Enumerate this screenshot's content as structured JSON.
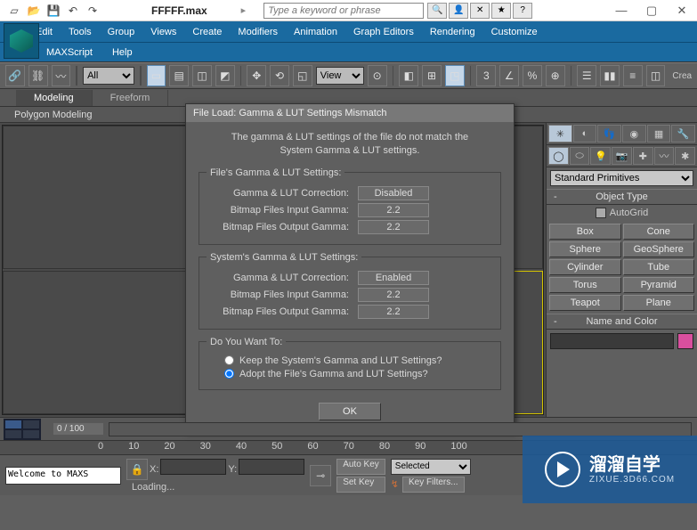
{
  "title": {
    "filename": "FFFFF.max",
    "search_placeholder": "Type a keyword or phrase"
  },
  "menu": [
    "Edit",
    "Tools",
    "Group",
    "Views",
    "Create",
    "Modifiers",
    "Animation",
    "Graph Editors",
    "Rendering",
    "Customize"
  ],
  "menu2": [
    "MAXScript",
    "Help"
  ],
  "toolbar": {
    "sel_filter": "All",
    "ref_coord": "View"
  },
  "ribbon": {
    "tabs": [
      "Modeling",
      "Freeform"
    ],
    "active": 0,
    "sub": "Polygon Modeling"
  },
  "cmd": {
    "category": "Standard Primitives",
    "object_type_head": "Object Type",
    "autogrid": "AutoGrid",
    "buttons": [
      "Box",
      "Cone",
      "Sphere",
      "GeoSphere",
      "Cylinder",
      "Tube",
      "Torus",
      "Pyramid",
      "Teapot",
      "Plane"
    ],
    "name_color_head": "Name and Color",
    "swatch": "#d94f9e"
  },
  "dialog": {
    "title": "File Load: Gamma & LUT Settings Mismatch",
    "intro1": "The gamma & LUT settings of the file do not match the",
    "intro2": "System Gamma & LUT settings.",
    "file_group": "File's Gamma & LUT Settings:",
    "sys_group": "System's Gamma & LUT Settings:",
    "row_correction": "Gamma & LUT Correction:",
    "row_in": "Bitmap Files Input Gamma:",
    "row_out": "Bitmap Files Output Gamma:",
    "file_correction": "Disabled",
    "file_in": "2.2",
    "file_out": "2.2",
    "sys_correction": "Enabled",
    "sys_in": "2.2",
    "sys_out": "2.2",
    "want_group": "Do You Want To:",
    "opt_keep": "Keep the System's Gamma and LUT Settings?",
    "opt_adopt": "Adopt the File's Gamma and LUT Settings?",
    "ok": "OK"
  },
  "timeline": {
    "frame_label": "0 / 100",
    "ticks": [
      "0",
      "10",
      "20",
      "30",
      "40",
      "50",
      "60",
      "70",
      "80",
      "90",
      "100"
    ]
  },
  "status": {
    "xlabel": "X:",
    "ylabel": "Y:",
    "prompt": "Welcome to MAXS",
    "loading": "Loading...",
    "autokey": "Auto Key",
    "setkey": "Set Key",
    "keymode": "Selected",
    "keyfilters": "Key Filters..."
  },
  "watermark": {
    "big": "溜溜自学",
    "small": "ZIXUE.3D66.COM"
  }
}
